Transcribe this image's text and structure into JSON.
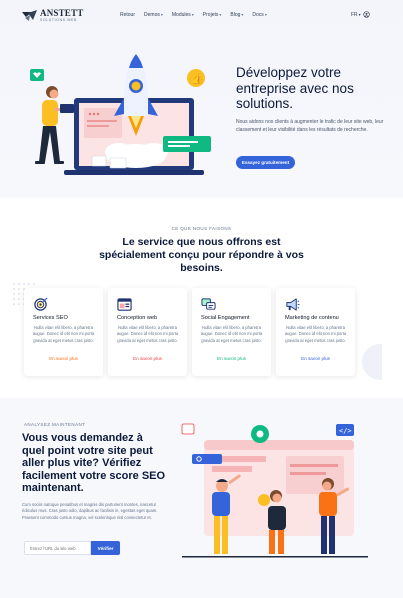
{
  "brand": {
    "name": "ANSTETT",
    "tagline": "SOLUTIONS WEB"
  },
  "nav": {
    "items": [
      {
        "label": "Retour",
        "dropdown": false
      },
      {
        "label": "Demos",
        "dropdown": true
      },
      {
        "label": "Modules",
        "dropdown": true
      },
      {
        "label": "Projets",
        "dropdown": true
      },
      {
        "label": "Blog",
        "dropdown": true
      },
      {
        "label": "Docs",
        "dropdown": true
      }
    ],
    "language": "FR"
  },
  "hero": {
    "title": "Développez votre entreprise avec nos solutions.",
    "text": "Nous aidons nos clients à augmenter le trafic de leur site web, leur classement et leur visibilité dans les résultats de recherche.",
    "cta": "Essayez gratuitement"
  },
  "services": {
    "eyebrow": "CE QUE NOUS FAISONS",
    "title": "Le service que nous offrons est spécialement conçu pour répondre à vos besoins.",
    "cards": [
      {
        "title": "Services SEO",
        "text": "Nulla vitae elit libero, a pharetra augue. Donec id elit non mi porta gravida at eget metus cras justo.",
        "link": "En savoir plus",
        "color": "#f97316",
        "icon": "seo-target-icon"
      },
      {
        "title": "Conception web",
        "text": "Nulla vitae elit libero, a pharetra augue. Donec id elit non mi porta gravida at eget metus cras justo.",
        "link": "En savoir plus",
        "color": "#ef4444",
        "icon": "browser-window-icon"
      },
      {
        "title": "Social Engagement",
        "text": "Nulla vitae elit libero, a pharetra augue. Donec id elit non mi porta gravida at eget metus cras justo.",
        "link": "En savoir plus",
        "color": "#10b981",
        "icon": "chat-bubbles-icon"
      },
      {
        "title": "Marketing de contenu",
        "text": "Nulla vitae elit libero, a pharetra augue. Donec id elit non mi porta gravida at eget metus cras justo.",
        "link": "En savoir plus",
        "color": "#3563d9",
        "icon": "megaphone-icon"
      }
    ]
  },
  "analyze": {
    "eyebrow": "ANALYSEZ MAINTENANT",
    "title": "Vous vous demandez à quel point votre site peut aller plus vite? Vérifiez facilement votre score SEO maintenant.",
    "text": "Cum sociis natoque penatibus et magnis dis parturient montes, nascetur ridiculus mus. Cras justo odio, dapibus ac facilisis in, egestas eget quam. Praesent commodo cursus magna, vel scelerisque nisl consectetur et.",
    "input_placeholder": "Entrez l'URL du site web",
    "button": "Vérifier"
  },
  "colors": {
    "primary": "#3563d9",
    "navy": "#0b1a3a",
    "muted": "#64748b"
  }
}
